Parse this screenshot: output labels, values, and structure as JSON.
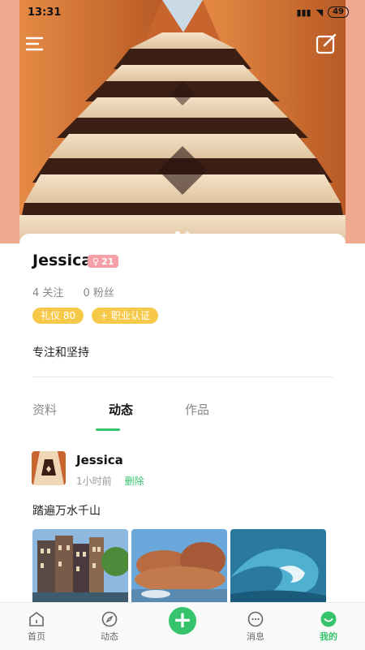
{
  "status_bar": {
    "time": "13:31",
    "battery": "49"
  },
  "profile": {
    "name": "Jessica",
    "level": "21",
    "stats": [
      {
        "count": "4",
        "label": "关注"
      },
      {
        "count": "0",
        "label": "粉丝"
      }
    ],
    "tags": [
      "礼仪 80",
      "+ 职业认证"
    ],
    "bio": "专注和坚持"
  },
  "tabs": [
    {
      "label": "资料",
      "active": false
    },
    {
      "label": "动态",
      "active": true
    },
    {
      "label": "作品",
      "active": false
    }
  ],
  "post": {
    "author": "Jessica",
    "time": "1小时前",
    "delete_label": "删除",
    "text": "踏遍万水千山",
    "images": [
      "city-street-photo",
      "rocky-coast-photo",
      "ocean-wave-photo"
    ]
  },
  "bottom_nav": [
    {
      "label": "首页",
      "icon": "home-icon"
    },
    {
      "label": "动态",
      "icon": "compass-icon"
    },
    {
      "label": "",
      "icon": "add-icon"
    },
    {
      "label": "消息",
      "icon": "message-icon"
    },
    {
      "label": "我的",
      "icon": "profile-icon"
    }
  ],
  "colors": {
    "accent": "#35c46b",
    "tag": "#f6c94a",
    "badge": "#f3a0a8"
  }
}
